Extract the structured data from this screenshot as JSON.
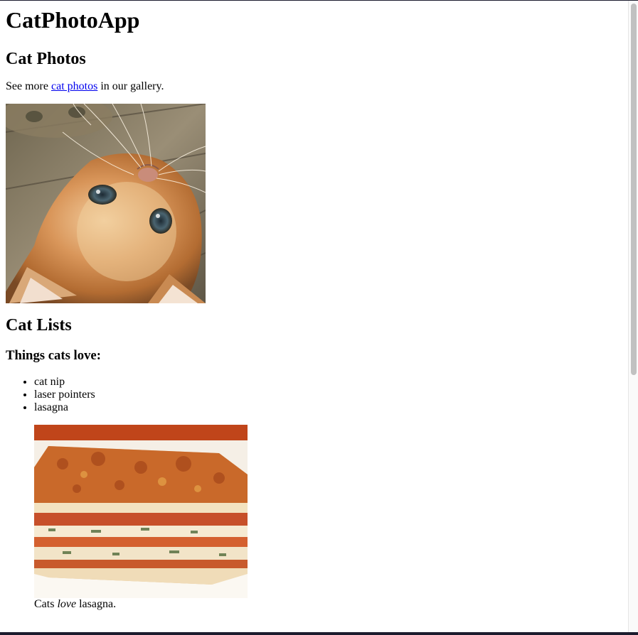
{
  "page": {
    "app_title": "CatPhotoApp",
    "section_photos_heading": "Cat Photos",
    "intro": {
      "before": "See more ",
      "link": "cat photos",
      "after": " in our gallery."
    },
    "cat_image_label": "cat",
    "section_lists_heading": "Cat Lists",
    "things_love_heading": "Things cats love:",
    "love_items": [
      "cat nip",
      "laser pointers",
      "lasagna"
    ],
    "lasagna_image_label": "lasagna",
    "caption": {
      "before": "Cats ",
      "emphasis": "love",
      "after": " lasagna."
    }
  },
  "colors": {
    "link": "#0000ee",
    "scroll_thumb": "#c1c1c1",
    "frame_edge": "#1c1c2e"
  }
}
